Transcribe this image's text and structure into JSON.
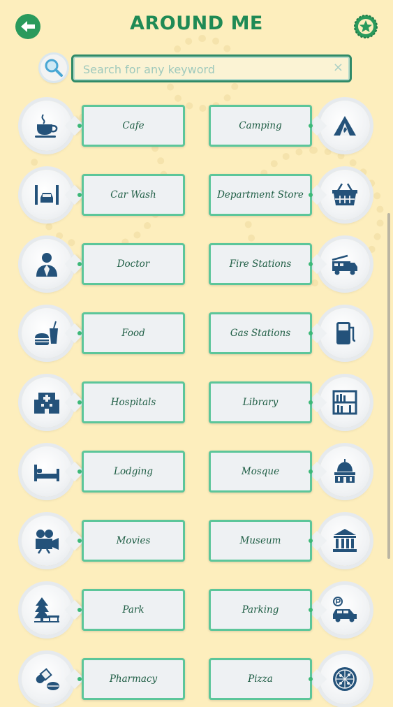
{
  "header": {
    "title": "AROUND ME",
    "back_icon": "back-arrow-icon",
    "fav_icon": "star-badge-icon",
    "accent": "#1f8a55"
  },
  "search": {
    "placeholder": "Search for any keyword",
    "value": "",
    "clear_label": "×"
  },
  "categories": [
    {
      "label": "Cafe",
      "icon": "coffee-cup-icon"
    },
    {
      "label": "Camping",
      "icon": "tent-icon"
    },
    {
      "label": "Car Wash",
      "icon": "car-wash-icon"
    },
    {
      "label": "Department Store",
      "icon": "shopping-basket-icon"
    },
    {
      "label": "Doctor",
      "icon": "doctor-icon"
    },
    {
      "label": "Fire Stations",
      "icon": "fire-truck-icon"
    },
    {
      "label": "Food",
      "icon": "burger-drink-icon"
    },
    {
      "label": "Gas Stations",
      "icon": "fuel-pump-icon"
    },
    {
      "label": "Hospitals",
      "icon": "hospital-building-icon"
    },
    {
      "label": "Library",
      "icon": "bookshelf-icon"
    },
    {
      "label": "Lodging",
      "icon": "bed-icon"
    },
    {
      "label": "Mosque",
      "icon": "mosque-icon"
    },
    {
      "label": "Movies",
      "icon": "film-camera-icon"
    },
    {
      "label": "Museum",
      "icon": "museum-icon"
    },
    {
      "label": "Park",
      "icon": "tree-bench-icon"
    },
    {
      "label": "Parking",
      "icon": "parking-car-icon"
    },
    {
      "label": "Pharmacy",
      "icon": "pill-capsule-icon"
    },
    {
      "label": "Pizza",
      "icon": "pizza-icon"
    }
  ]
}
